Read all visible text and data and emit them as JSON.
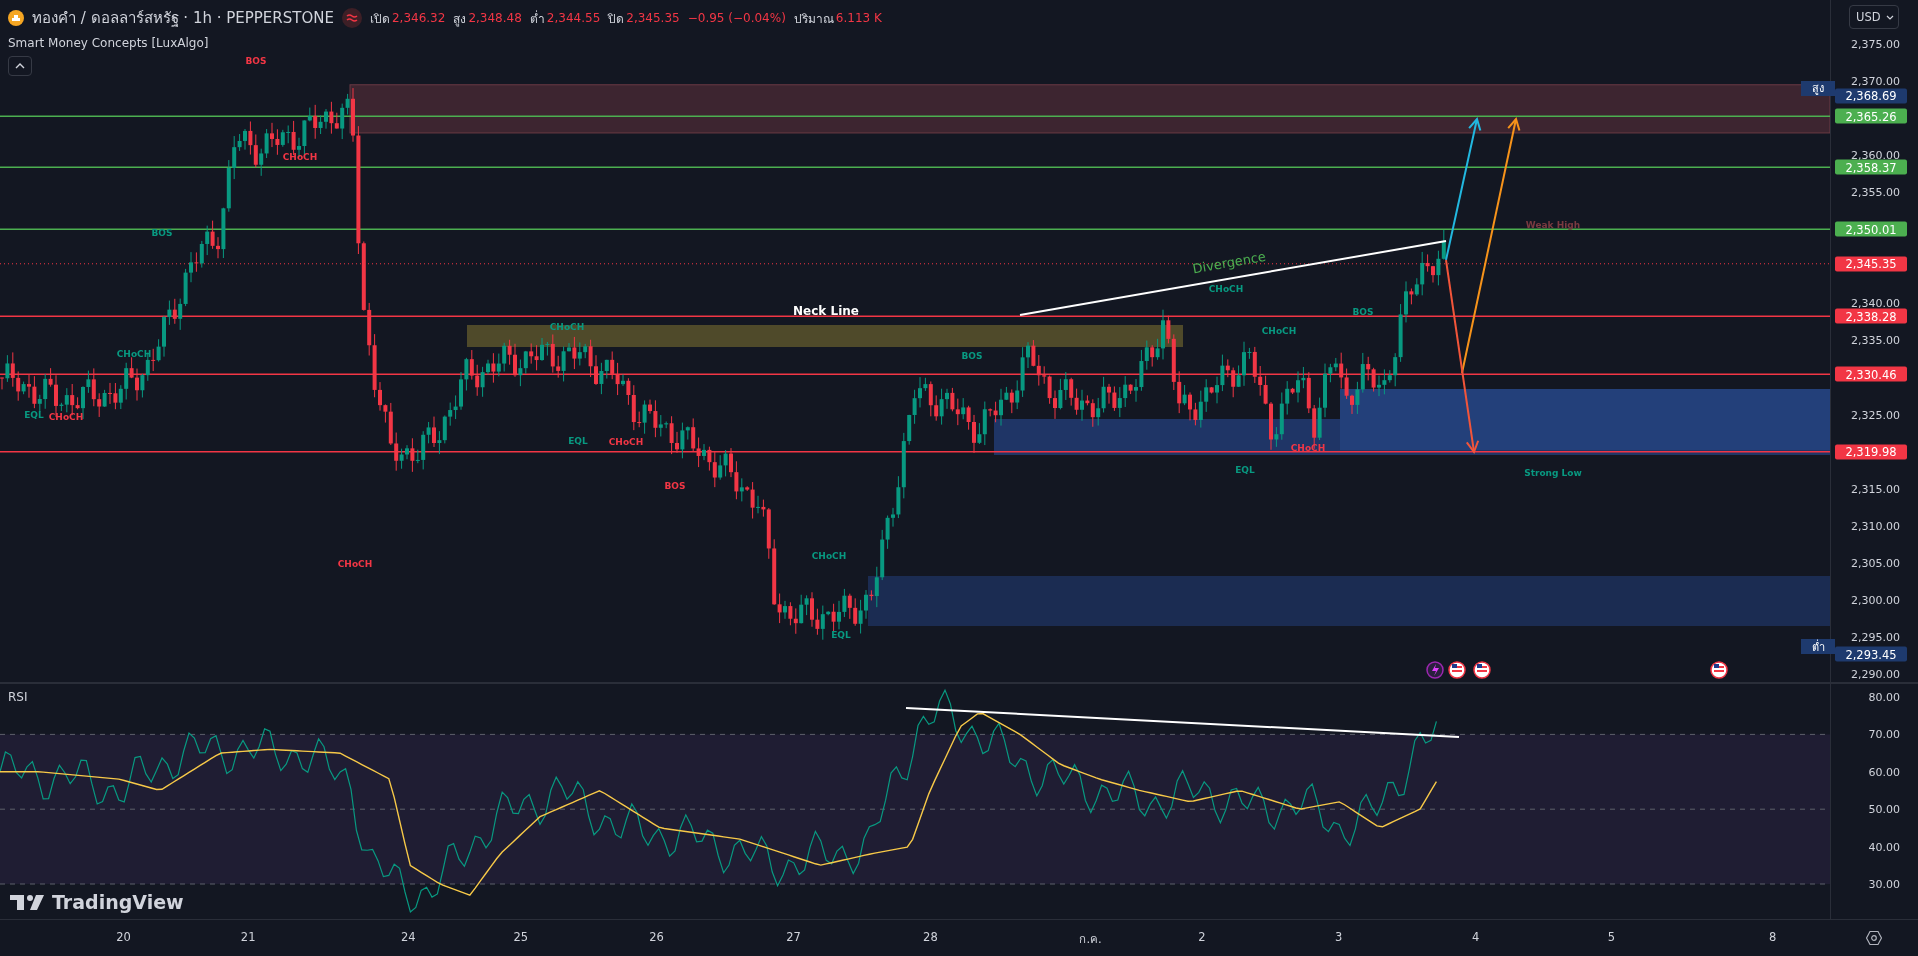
{
  "header": {
    "symbol": "ทองคำ / ดอลลาร์สหรัฐ · 1h · PEPPERSTONE",
    "ohlc": [
      {
        "label": "เปิด",
        "value": "2,346.32"
      },
      {
        "label": "สูง",
        "value": "2,348.48"
      },
      {
        "label": "ต่ำ",
        "value": "2,344.55"
      },
      {
        "label": "ปิด",
        "value": "2,345.35"
      }
    ],
    "change": "−0.95 (−0.04%)",
    "volume": {
      "label": "ปริมาณ",
      "value": "6.113 K"
    },
    "indicator": "Smart Money Concepts [LuxAlgo]"
  },
  "currency": "USD",
  "price_axis": [
    "2,375.00",
    "2,370.00",
    "2,360.00",
    "2,355.00",
    "2,340.00",
    "2,335.00",
    "2,325.00",
    "2,315.00",
    "2,310.00",
    "2,305.00",
    "2,300.00",
    "2,295.00",
    "2,290.00"
  ],
  "price_levels": [
    {
      "value": "2,365.26",
      "color": "#4caf50",
      "kind": "solid"
    },
    {
      "value": "2,358.37",
      "color": "#4caf50",
      "kind": "solid"
    },
    {
      "value": "2,350.01",
      "color": "#4caf50",
      "kind": "solid"
    },
    {
      "value": "2,345.35",
      "color": "#f23645",
      "kind": "dotted"
    },
    {
      "value": "2,338.28",
      "color": "#f23645",
      "kind": "solid"
    },
    {
      "value": "2,330.46",
      "color": "#f23645",
      "kind": "solid"
    },
    {
      "value": "2,319.98",
      "color": "#f23645",
      "kind": "solid"
    }
  ],
  "extremes": [
    {
      "label": "สูง",
      "value": "2,368.69"
    },
    {
      "label": "ต่ำ",
      "value": "2,293.45"
    }
  ],
  "annotations": [
    {
      "text": "BOS",
      "kind": "bos",
      "color": "#f23645"
    },
    {
      "text": "CHoCH",
      "kind": "choch",
      "color": "#f23645"
    },
    {
      "text": "BOS",
      "kind": "bos",
      "color": "#089981"
    },
    {
      "text": "CHoCH",
      "kind": "choch",
      "color": "#089981"
    },
    {
      "text": "EQL",
      "kind": "eql",
      "color": "#089981"
    },
    {
      "text": "CHoCH",
      "kind": "choch",
      "color": "#f23645"
    },
    {
      "text": "CHoCH",
      "kind": "choch",
      "color": "#089981"
    },
    {
      "text": "EQL",
      "kind": "eql",
      "color": "#089981"
    },
    {
      "text": "CHoCH",
      "kind": "choch",
      "color": "#f23645"
    },
    {
      "text": "BOS",
      "kind": "bos",
      "color": "#f23645"
    },
    {
      "text": "BOS",
      "kind": "bos",
      "color": "#089981"
    },
    {
      "text": "Neck Line",
      "kind": "neckline",
      "color": "#ffffff"
    },
    {
      "text": "Divergence",
      "kind": "divergence",
      "color": "#4caf50"
    },
    {
      "text": "CHoCH",
      "kind": "choch",
      "color": "#089981"
    },
    {
      "text": "CHoCH",
      "kind": "choch",
      "color": "#089981"
    },
    {
      "text": "BOS",
      "kind": "bos",
      "color": "#089981"
    },
    {
      "text": "CHoCH",
      "kind": "choch",
      "color": "#f23645"
    },
    {
      "text": "EQL",
      "kind": "eql",
      "color": "#089981"
    },
    {
      "text": "Weak High",
      "kind": "weak_high",
      "color": "#7a3a40"
    },
    {
      "text": "Strong Low",
      "kind": "strong_low",
      "color": "#089981"
    },
    {
      "text": "CHoCH",
      "kind": "choch",
      "color": "#f23645"
    },
    {
      "text": "CHoCH",
      "kind": "choch",
      "color": "#089981"
    },
    {
      "text": "EQL",
      "kind": "eql",
      "color": "#089981"
    }
  ],
  "rsi": {
    "title": "RSI",
    "axis": [
      "80.00",
      "70.00",
      "60.00",
      "50.00",
      "40.00",
      "30.00"
    ]
  },
  "logo": "TradingView",
  "time_axis": [
    "20",
    "21",
    "24",
    "25",
    "26",
    "27",
    "28",
    "ก.ค.",
    "2",
    "3",
    "4",
    "5",
    "8"
  ]
}
